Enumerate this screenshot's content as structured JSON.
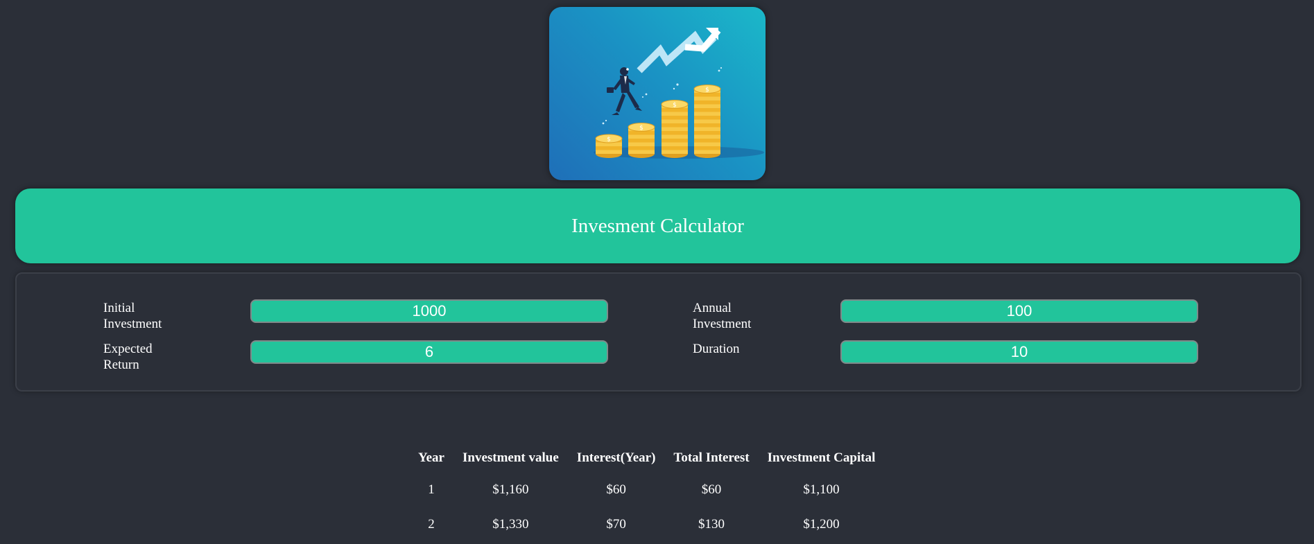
{
  "page": {
    "title": "Invesment Calculator"
  },
  "hero": {
    "image": "investment-growth-illustration",
    "coin_symbol": "$"
  },
  "form": {
    "initial_investment": {
      "label": "Initial Investment",
      "value": "1000"
    },
    "annual_investment": {
      "label": "Annual Investment",
      "value": "100"
    },
    "expected_return": {
      "label": "Expected Return",
      "value": "6"
    },
    "duration": {
      "label": "Duration",
      "value": "10"
    }
  },
  "results": {
    "headers": [
      "Year",
      "Investment value",
      "Interest(Year)",
      "Total Interest",
      "Investment Capital"
    ],
    "rows": [
      [
        "1",
        "$1,160",
        "$60",
        "$60",
        "$1,100"
      ],
      [
        "2",
        "$1,330",
        "$70",
        "$130",
        "$1,200"
      ]
    ]
  },
  "colors": {
    "background": "#2b2f38",
    "accent": "#22c49b",
    "hero_blue": "#1f6fb8",
    "hero_cyan": "#1bb8c9",
    "coin_gold": "#f5c43b"
  }
}
